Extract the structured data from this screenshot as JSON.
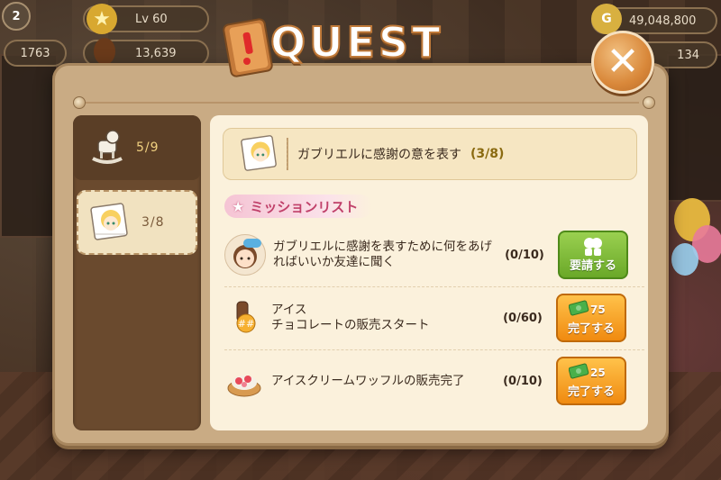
{
  "hud": {
    "level_label": "Lv 60",
    "stat_primary": "1763",
    "stat_secondary": "13,639",
    "gold": "49,048,800",
    "gems": "134",
    "badge_number": "2"
  },
  "dialog": {
    "title": "QUEST",
    "close_symbol": "✕"
  },
  "quest_tabs": [
    {
      "progress": "5/9",
      "icon": "rocking-horse-icon",
      "active": false
    },
    {
      "progress": "3/8",
      "icon": "character-card-icon",
      "active": true
    }
  ],
  "current_quest": {
    "title": "ガブリエルに感謝の意を表す",
    "progress": "(3/8)"
  },
  "mission_list_label": "ミッションリスト",
  "missions": [
    {
      "icon": "friend-avatar-icon",
      "text": "ガブリエルに感謝を表すために何をあげればいいか友達に聞く",
      "count": "(0/10)",
      "button_label": "要請する",
      "button_color": "#7cbc38",
      "reward": "",
      "reward_icon": "friends-icon"
    },
    {
      "icon": "chocolate-ice-icon",
      "text_line1": "アイス",
      "text_line2": "チョコレートの販売スタート",
      "count": "(0/60)",
      "button_label": "完了する",
      "button_color": "#f6a41e",
      "reward": "75",
      "reward_icon": "cash-icon"
    },
    {
      "icon": "ice-waffle-icon",
      "text": "アイスクリームワッフルの販売完了",
      "count": "(0/10)",
      "button_label": "完了する",
      "button_color": "#f6a41e",
      "reward": "25",
      "reward_icon": "cash-icon"
    }
  ],
  "colors": {
    "panel_bg": "#c9ab84",
    "left_panel": "#6a4a2e",
    "content_bg": "#fbf1dc",
    "accent_pink": "#c0406a"
  }
}
